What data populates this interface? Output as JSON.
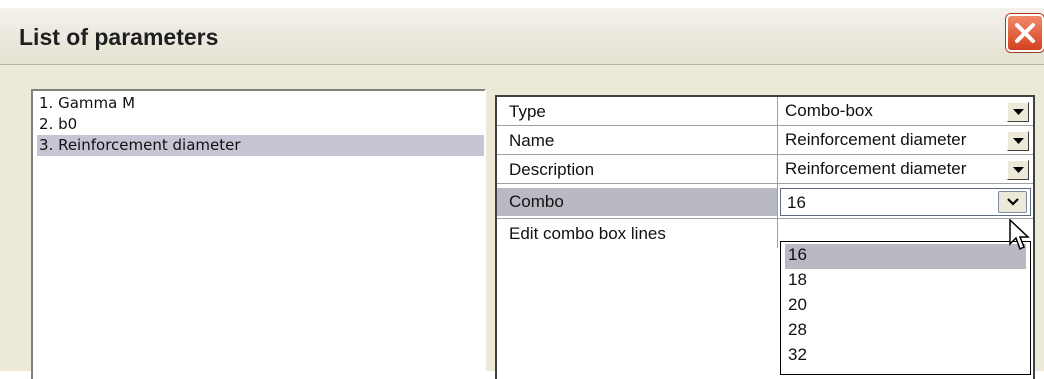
{
  "window": {
    "title": "List of parameters",
    "close_icon": "close-icon"
  },
  "parameters": [
    {
      "label": "1. Gamma M",
      "selected": false
    },
    {
      "label": "2. b0",
      "selected": false
    },
    {
      "label": "3. Reinforcement diameter",
      "selected": true
    }
  ],
  "properties": {
    "type": {
      "label": "Type",
      "value": "Combo-box"
    },
    "name": {
      "label": "Name",
      "value": "Reinforcement diameter"
    },
    "description": {
      "label": "Description",
      "value": "Reinforcement diameter"
    },
    "combo": {
      "label": "Combo",
      "value": "16"
    },
    "edit_lines": {
      "label": "Edit combo box lines"
    }
  },
  "combo_options": [
    "16",
    "18",
    "20",
    "28",
    "32"
  ],
  "combo_selected": "16",
  "colors": {
    "dialog_bg": "#ece9d8",
    "selection": "#c5c5d3",
    "close_button": "#d3411f"
  }
}
